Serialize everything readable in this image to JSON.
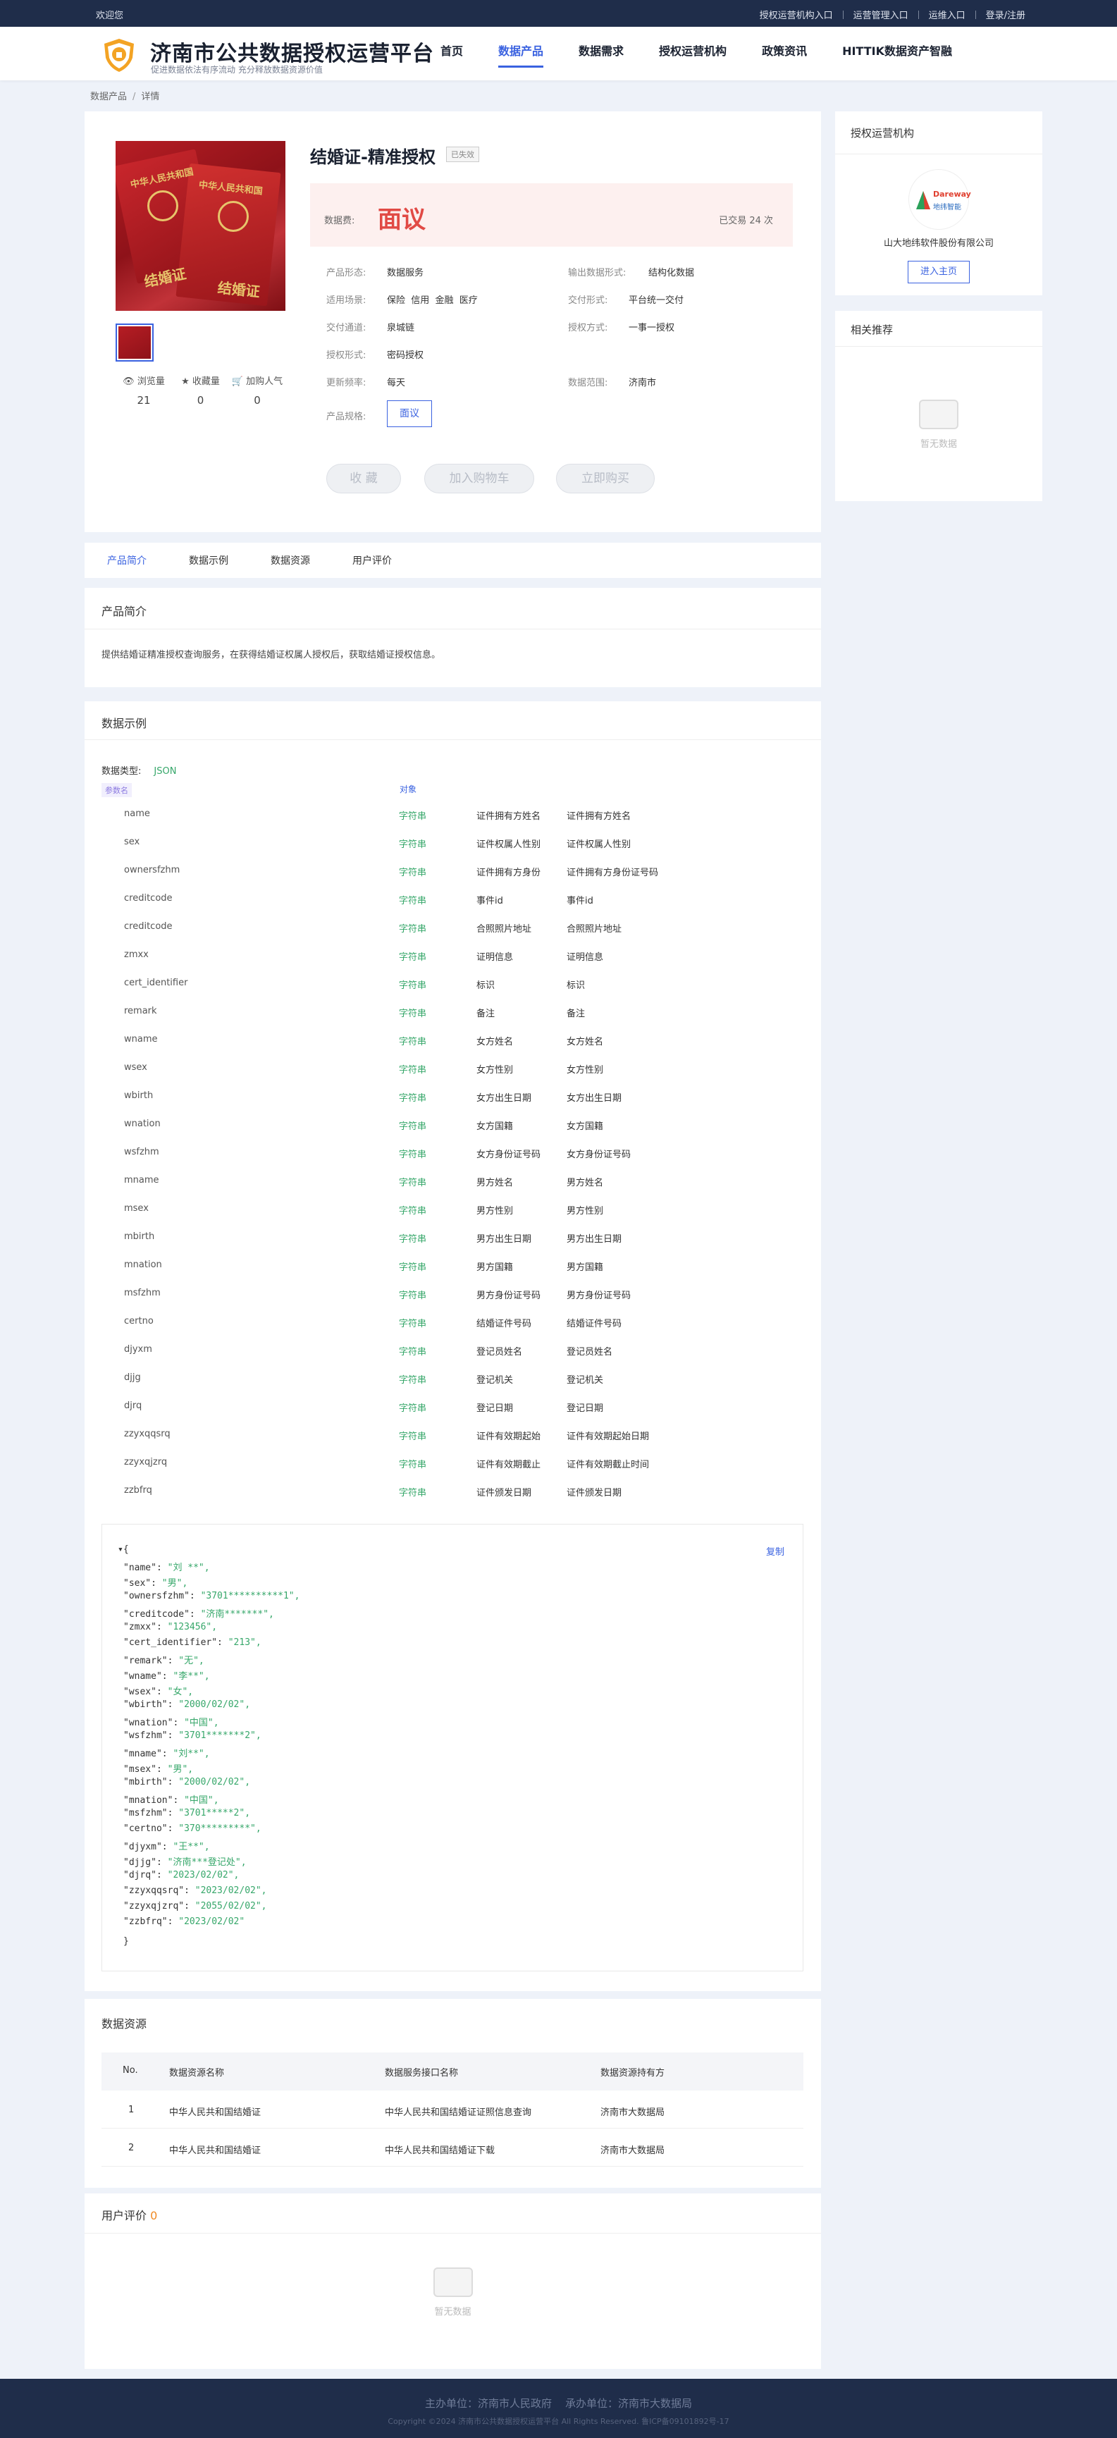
{
  "topbar": {
    "welcome": "欢迎您",
    "links": [
      "授权运营机构入口",
      "运营管理入口",
      "运维入口",
      "登录/注册"
    ]
  },
  "site": {
    "title": "济南市公共数据授权运营平台",
    "subtitle": "促进数据依法有序流动 充分释放数据资源价值"
  },
  "nav": [
    "首页",
    "数据产品",
    "数据需求",
    "授权运营机构",
    "政策资讯",
    "HITTIK数据资产智融"
  ],
  "nav_active": 1,
  "breadcrumb": [
    "数据产品",
    "详情"
  ],
  "product": {
    "title": "结婚证-精准授权",
    "status": "已失效",
    "price_label": "数据费:",
    "price": "面议",
    "traded": "已交易 24 次",
    "attrs_left": [
      [
        "产品形态:",
        "数据服务"
      ],
      [
        "适用场景:",
        "保险  信用  金融  医疗"
      ],
      [
        "交付通道:",
        "泉城链"
      ],
      [
        "授权形式:",
        "密码授权"
      ],
      [
        "更新频率:",
        "每天"
      ]
    ],
    "attrs_right": [
      [
        "输出数据形式:",
        "结构化数据"
      ],
      [
        "交付形式:",
        "平台统一交付"
      ],
      [
        "授权方式:",
        "一事一授权"
      ],
      [
        "数据范围:",
        "济南市"
      ]
    ],
    "spec_label": "产品规格:",
    "spec": "面议",
    "actions": [
      "收 藏",
      "加入购物车",
      "立即购买"
    ],
    "stats": [
      {
        "label": "浏览量",
        "value": "21",
        "icon": "eye-icon"
      },
      {
        "label": "收藏量",
        "value": "0",
        "icon": "star-icon"
      },
      {
        "label": "加购人气",
        "value": "0",
        "icon": "cart-icon"
      }
    ],
    "image_text": {
      "cover": "中华人民共和国",
      "book": "结婚证"
    }
  },
  "org": {
    "title": "授权运营机构",
    "name": "山大地纬软件股份有限公司",
    "logo_brand": "Dareway",
    "logo_cn": "地纬智能",
    "btn": "进入主页"
  },
  "related": {
    "title": "相关推荐",
    "empty": "暂无数据"
  },
  "tabs": [
    "产品简介",
    "数据示例",
    "数据资源",
    "用户评价"
  ],
  "intro": {
    "title": "产品简介",
    "text": "提供结婚证精准授权查询服务，在获得结婚证权属人授权后，获取结婚证授权信息。"
  },
  "sample": {
    "title": "数据示例",
    "type_label": "数据类型:",
    "type": "JSON",
    "col_param": "参数名",
    "col_obj": "对象",
    "rows": [
      [
        "name",
        "字符串",
        "证件拥有方姓名",
        "证件拥有方姓名"
      ],
      [
        "sex",
        "字符串",
        "证件权属人性别",
        "证件权属人性别"
      ],
      [
        "ownersfzhm",
        "字符串",
        "证件拥有方身份",
        "证件拥有方身份证号码"
      ],
      [
        "creditcode",
        "字符串",
        "事件id",
        "事件id"
      ],
      [
        "creditcode",
        "字符串",
        "合照照片地址",
        "合照照片地址"
      ],
      [
        "zmxx",
        "字符串",
        "证明信息",
        "证明信息"
      ],
      [
        "cert_identifier",
        "字符串",
        "标识",
        "标识"
      ],
      [
        "remark",
        "字符串",
        "备注",
        "备注"
      ],
      [
        "wname",
        "字符串",
        "女方姓名",
        "女方姓名"
      ],
      [
        "wsex",
        "字符串",
        "女方性别",
        "女方性别"
      ],
      [
        "wbirth",
        "字符串",
        "女方出生日期",
        "女方出生日期"
      ],
      [
        "wnation",
        "字符串",
        "女方国籍",
        "女方国籍"
      ],
      [
        "wsfzhm",
        "字符串",
        "女方身份证号码",
        "女方身份证号码"
      ],
      [
        "mname",
        "字符串",
        "男方姓名",
        "男方姓名"
      ],
      [
        "msex",
        "字符串",
        "男方性别",
        "男方性别"
      ],
      [
        "mbirth",
        "字符串",
        "男方出生日期",
        "男方出生日期"
      ],
      [
        "mnation",
        "字符串",
        "男方国籍",
        "男方国籍"
      ],
      [
        "msfzhm",
        "字符串",
        "男方身份证号码",
        "男方身份证号码"
      ],
      [
        "certno",
        "字符串",
        "结婚证件号码",
        "结婚证件号码"
      ],
      [
        "djyxm",
        "字符串",
        "登记员姓名",
        "登记员姓名"
      ],
      [
        "djjg",
        "字符串",
        "登记机关",
        "登记机关"
      ],
      [
        "djrq",
        "字符串",
        "登记日期",
        "登记日期"
      ],
      [
        "zzyxqqsrq",
        "字符串",
        "证件有效期起始",
        "证件有效期起始日期"
      ],
      [
        "zzyxqjzrq",
        "字符串",
        "证件有效期截止",
        "证件有效期截止时间"
      ],
      [
        "zzbfrq",
        "字符串",
        "证件颁发日期",
        "证件颁发日期"
      ]
    ],
    "copy": "复制",
    "json_lines": [
      [
        "\"name\": ",
        "\"刘 **\","
      ],
      [
        "\"sex\": ",
        "\"男\","
      ],
      [
        "\"ownersfzhm\": ",
        "\"3701**********1\","
      ],
      [
        "\"creditcode\": ",
        "\"济南*******\","
      ],
      [
        "\"zmxx\": ",
        "\"123456\","
      ],
      [
        "\"cert_identifier\": ",
        "\"213\","
      ],
      [
        "\"remark\": ",
        "\"无\","
      ],
      [
        "\"wname\": ",
        "\"李**\","
      ],
      [
        "\"wsex\": ",
        "\"女\","
      ],
      [
        "\"wbirth\": ",
        "\"2000/02/02\","
      ],
      [
        "\"wnation\": ",
        "\"中国\","
      ],
      [
        "\"wsfzhm\": ",
        "\"3701*******2\","
      ],
      [
        "\"mname\": ",
        "\"刘**\","
      ],
      [
        "\"msex\": ",
        "\"男\","
      ],
      [
        "\"mbirth\": ",
        "\"2000/02/02\","
      ],
      [
        "\"mnation\": ",
        "\"中国\","
      ],
      [
        "\"msfzhm\": ",
        "\"3701*****2\","
      ],
      [
        "\"certno\": ",
        "\"370*********\","
      ],
      [
        "\"djyxm\": ",
        "\"王**\","
      ],
      [
        "\"djjg\": ",
        "\"济南***登记处\","
      ],
      [
        "\"djrq\": ",
        "\"2023/02/02\","
      ],
      [
        "\"zzyxqqsrq\": ",
        "\"2023/02/02\","
      ],
      [
        "\"zzyxqjzrq\": ",
        "\"2055/02/02\","
      ],
      [
        "\"zzbfrq\": ",
        "\"2023/02/02\""
      ]
    ]
  },
  "resource": {
    "title": "数据资源",
    "headers": [
      "No.",
      "数据资源名称",
      "数据服务接口名称",
      "数据资源持有方"
    ],
    "rows": [
      [
        "1",
        "中华人民共和国结婚证",
        "中华人民共和国结婚证证照信息查询",
        "济南市大数据局"
      ],
      [
        "2",
        "中华人民共和国结婚证",
        "中华人民共和国结婚证下载",
        "济南市大数据局"
      ]
    ]
  },
  "review": {
    "title": "用户评价",
    "count": "0",
    "empty": "暂无数据"
  },
  "footer": {
    "line1": "主办单位：济南市人民政府    承办单位：济南市大数据局",
    "line2": "Copyright ©2024 济南市公共数据授权运营平台 All Rights Reserved. 鲁ICP备09101892号-17"
  },
  "colors": {
    "primary": "#3a62e0",
    "price": "#e14a45",
    "string_type": "#36a76a",
    "dark": "#1f2d4a"
  }
}
